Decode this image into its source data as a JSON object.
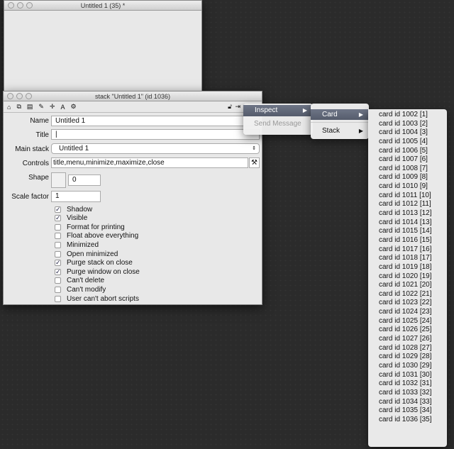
{
  "window1": {
    "title": "Untitled 1 (35) *"
  },
  "inspector": {
    "title": "stack \"Untitled 1\" (id 1036)",
    "name_label": "Name",
    "name_value": "Untitled 1",
    "title_label": "Title",
    "title_value": "",
    "mainstack_label": "Main stack",
    "mainstack_value": "Untitled 1",
    "controls_label": "Controls",
    "controls_value": "title,menu,minimize,maximize,close",
    "shape_label": "Shape",
    "shape_value": "0",
    "scale_label": "Scale factor",
    "scale_value": "1",
    "checkboxes": [
      {
        "label": "Shadow",
        "checked": true
      },
      {
        "label": "Visible",
        "checked": true
      },
      {
        "label": "Format for printing",
        "checked": false
      },
      {
        "label": "Float above everything",
        "checked": false
      },
      {
        "label": "Minimized",
        "checked": false
      },
      {
        "label": "Open minimized",
        "checked": false
      },
      {
        "label": "Purge stack on close",
        "checked": true
      },
      {
        "label": "Purge window on close",
        "checked": true
      },
      {
        "label": "Can't delete",
        "checked": false
      },
      {
        "label": "Can't modify",
        "checked": false
      },
      {
        "label": "User can't abort scripts",
        "checked": false
      }
    ]
  },
  "menu1": {
    "inspect": "Inspect",
    "send": "Send Message"
  },
  "menu2": {
    "card": "Card",
    "stack": "Stack"
  },
  "cards": [
    "card id 1002 [1]",
    "card id 1003 [2]",
    "card id 1004 [3]",
    "card id 1005 [4]",
    "card id 1006 [5]",
    "card id 1007 [6]",
    "card id 1008 [7]",
    "card id 1009 [8]",
    "card id 1010 [9]",
    "card id 1011 [10]",
    "card id 1012 [11]",
    "card id 1013 [12]",
    "card id 1014 [13]",
    "card id 1015 [14]",
    "card id 1016 [15]",
    "card id 1017 [16]",
    "card id 1018 [17]",
    "card id 1019 [18]",
    "card id 1020 [19]",
    "card id 1021 [20]",
    "card id 1022 [21]",
    "card id 1023 [22]",
    "card id 1024 [23]",
    "card id 1025 [24]",
    "card id 1026 [25]",
    "card id 1027 [26]",
    "card id 1028 [27]",
    "card id 1029 [28]",
    "card id 1030 [29]",
    "card id 1031 [30]",
    "card id 1032 [31]",
    "card id 1033 [32]",
    "card id 1034 [33]",
    "card id 1035 [34]",
    "card id 1036 [35]"
  ]
}
